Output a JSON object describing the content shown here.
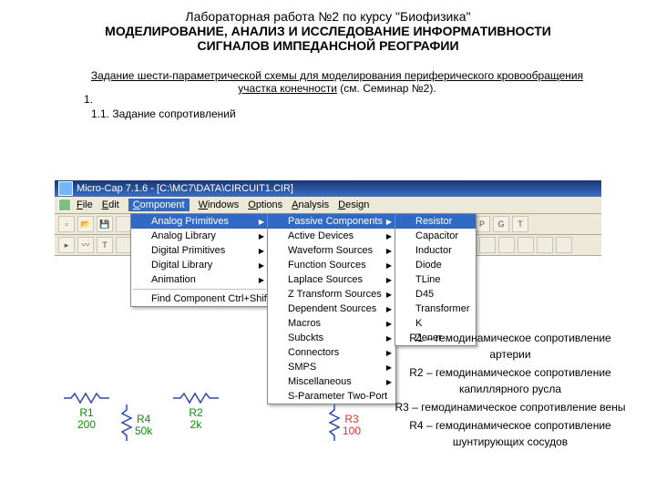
{
  "doc": {
    "title_line1": "Лабораторная работа №2 по курсу \"Биофизика\"",
    "title_line2": "МОДЕЛИРОВАНИЕ, АНАЛИЗ И ИССЛЕДОВАНИЕ ИНФОРМАТИВНОСТИ",
    "title_line3": "СИГНАЛОВ ИМПЕДАНСНОЙ РЕОГРАФИИ",
    "task_num": "1.",
    "task_underlined": "Задание шести-параметрической схемы для моделирования периферического кровообращения участка конечности",
    "task_tail": " (см. Семинар №2).",
    "subtask": "1.1. Задание  сопротивлений"
  },
  "app": {
    "title": "Micro-Cap 7.1.6 - [C:\\MC7\\DATA\\CIRCUIT1.CIR]",
    "menubar": [
      "File",
      "Edit",
      "Component",
      "Windows",
      "Options",
      "Analysis",
      "Design"
    ],
    "menu1": {
      "items": [
        "Analog Primitives",
        "Analog Library",
        "Digital Primitives",
        "Digital Library",
        "Animation"
      ],
      "find": "Find Component   Ctrl+Shift+F"
    },
    "menu2": {
      "items": [
        "Passive Components",
        "Active Devices",
        "Waveform Sources",
        "Function Sources",
        "Laplace Sources",
        "Z Transform Sources",
        "Dependent Sources",
        "Macros",
        "Subckts",
        "Connectors",
        "SMPS",
        "Miscellaneous",
        "S-Parameter Two-Port"
      ]
    },
    "menu3": {
      "items": [
        "Resistor",
        "Capacitor",
        "Inductor",
        "Diode",
        "TLine",
        "D45",
        "Transformer",
        "K",
        "Zener"
      ]
    },
    "tool_letters": [
      "P",
      "G",
      "T"
    ]
  },
  "resistors": {
    "r1_name": "R1",
    "r1_val": "200",
    "r2_name": "R2",
    "r2_val": "2k",
    "r3_name": "R3",
    "r3_val": "100",
    "r4_name": "R4",
    "r4_val": "50k"
  },
  "rdesc": {
    "r1": "R1 – гемодинамическое сопротивление артерии",
    "r2": "R2 – гемодинамическое сопротивление капиллярного русла",
    "r3": "R3 – гемодинамическое сопротивление вены",
    "r4": "R4 – гемодинамическое сопротивление шунтирующих сосудов"
  }
}
